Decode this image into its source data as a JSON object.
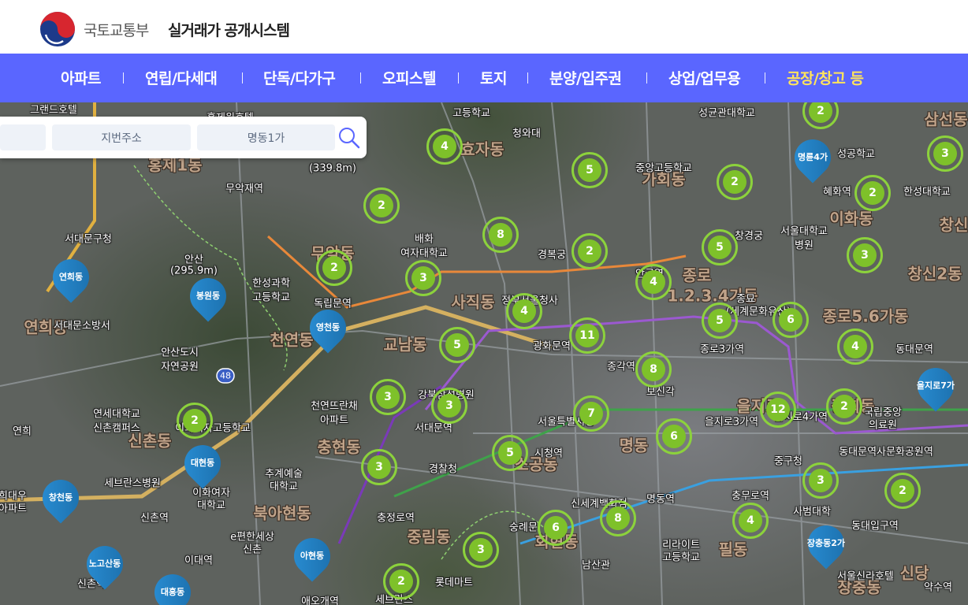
{
  "header": {
    "ministry": "국토교통부",
    "system_name": "실거래가 공개시스템"
  },
  "nav": {
    "items": [
      {
        "label": "아파트"
      },
      {
        "label": "연립/다세대"
      },
      {
        "label": "단독/다가구"
      },
      {
        "label": "오피스텔"
      },
      {
        "label": "토지"
      },
      {
        "label": "분양/입주권"
      },
      {
        "label": "상업/업무용"
      },
      {
        "label": "공장/창고 등",
        "active": true
      }
    ],
    "active_color": "#ffe45c",
    "bg_color": "#5a66ff"
  },
  "search": {
    "field1": "",
    "field2": "지번주소",
    "field3": "명동1가",
    "icon": "search-icon"
  },
  "map": {
    "clusters": [
      "2",
      "4",
      "5",
      "2",
      "2",
      "8",
      "2",
      "2",
      "3",
      "5",
      "3",
      "4",
      "5",
      "5",
      "4",
      "6",
      "6",
      "11",
      "4",
      "5",
      "3",
      "8",
      "3",
      "2",
      "7",
      "12",
      "2",
      "6",
      "5",
      "3",
      "3",
      "4",
      "2",
      "8",
      "6",
      "3",
      "2"
    ],
    "dong_pins": [
      "명륜4가",
      "연희동",
      "봉원동",
      "영천동",
      "을지로7가",
      "대현동",
      "창천동",
      "노고산동",
      "아현동",
      "대흥동",
      "장충동2가"
    ],
    "districts": [
      "효자동",
      "홍제1동",
      "무악동",
      "사직동",
      "교남동",
      "천연동",
      "가회동",
      "종로",
      "1.2.3.4가동",
      "종로5.6가동",
      "이화동",
      "삼선동",
      "창신2동",
      "창신",
      "연희동",
      "신촌동",
      "충현동",
      "북아현동",
      "소공동",
      "명동",
      "을지로",
      "광희동",
      "중림동",
      "회현동",
      "필동",
      "장충동",
      "신당"
    ],
    "places": [
      "그랜드호텔",
      "홍제원호텔",
      "성균관대학교",
      "청와대",
      "고등학교",
      "성공학교",
      "무악재역",
      "중앙고등학교",
      "혜화역",
      "한성대학교",
      "서대문구청",
      "배화",
      "여자대학교",
      "경복궁",
      "창경궁",
      "서울대학교",
      "병원",
      "안산",
      "(295.9m)",
      "(339.8m)",
      "한성과학",
      "고등학교",
      "독립문역",
      "안국역",
      "종묘",
      "(세계문화유산)",
      "서대문소방서",
      "정부서울청사",
      "광화문역",
      "종로3가역",
      "동대문역",
      "안산도시",
      "자연공원",
      "종각역",
      "보신각",
      "천연뜨란채",
      "아파트",
      "강북삼성병원",
      "연세대학교",
      "신촌캠퍼스",
      "이화여자고등학교",
      "서대문역",
      "서울특별시청",
      "을지로3가역",
      "을지로4가역",
      "국립중앙",
      "의료원",
      "연희",
      "동대문역사문화공원역",
      "세브란스병원",
      "시청역",
      "중구청",
      "추계예술",
      "대학교",
      "경찰청",
      "충무로역",
      "사범대학",
      "희대우",
      "아파트",
      "이화여자",
      "대학교",
      "신촌역",
      "충정로역",
      "신세계백화점",
      "명동역",
      "동대입구역",
      "e편한세상",
      "신촌",
      "숭례문",
      "리라이트",
      "고등학교",
      "이대역",
      "롯데마트",
      "남산관",
      "서울신라호텔",
      "약수역",
      "신촌역",
      "애오개역",
      "세브란스"
    ],
    "road_label": "48"
  }
}
